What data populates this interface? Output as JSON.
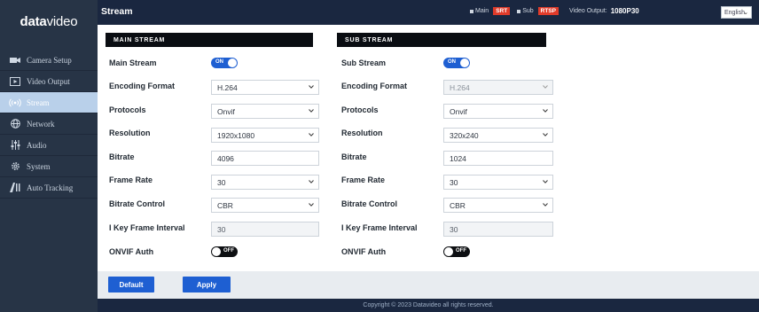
{
  "logo": {
    "text_bold": "data",
    "text_thin": "video"
  },
  "sidebar": {
    "items": [
      {
        "label": "Camera Setup",
        "icon": "camera-icon",
        "active": false
      },
      {
        "label": "Video Output",
        "icon": "video-output-icon",
        "active": false
      },
      {
        "label": "Stream",
        "icon": "stream-icon",
        "active": true
      },
      {
        "label": "Network",
        "icon": "network-icon",
        "active": false
      },
      {
        "label": "Audio",
        "icon": "audio-icon",
        "active": false
      },
      {
        "label": "System",
        "icon": "gear-icon",
        "active": false
      },
      {
        "label": "Auto Tracking",
        "icon": "auto-tracking-icon",
        "active": false
      }
    ]
  },
  "header": {
    "title": "Stream",
    "main_label": "Main",
    "main_tag": "SRT",
    "sub_label": "Sub",
    "sub_tag": "RTSP",
    "video_output_label": "Video Output:",
    "video_output_value": "1080P30",
    "language": "English"
  },
  "main_stream": {
    "section_title": "MAIN STREAM",
    "enable_label": "Main Stream",
    "enable_state": "ON",
    "encoding_label": "Encoding Format",
    "encoding_value": "H.264",
    "protocols_label": "Protocols",
    "protocols_value": "Onvif",
    "resolution_label": "Resolution",
    "resolution_value": "1920x1080",
    "bitrate_label": "Bitrate",
    "bitrate_value": "4096",
    "framerate_label": "Frame Rate",
    "framerate_value": "30",
    "bitrate_control_label": "Bitrate Control",
    "bitrate_control_value": "CBR",
    "ikey_label": "I Key Frame Interval",
    "ikey_value": "30",
    "onvif_auth_label": "ONVIF Auth",
    "onvif_auth_state": "OFF"
  },
  "sub_stream": {
    "section_title": "SUB STREAM",
    "enable_label": "Sub Stream",
    "enable_state": "ON",
    "encoding_label": "Encoding Format",
    "encoding_value": "H.264",
    "protocols_label": "Protocols",
    "protocols_value": "Onvif",
    "resolution_label": "Resolution",
    "resolution_value": "320x240",
    "bitrate_label": "Bitrate",
    "bitrate_value": "1024",
    "framerate_label": "Frame Rate",
    "framerate_value": "30",
    "bitrate_control_label": "Bitrate Control",
    "bitrate_control_value": "CBR",
    "ikey_label": "I Key Frame Interval",
    "ikey_value": "30",
    "onvif_auth_label": "ONVIF Auth",
    "onvif_auth_state": "OFF"
  },
  "buttons": {
    "default_label": "Default",
    "apply_label": "Apply"
  },
  "footer": {
    "copyright": "Copyright © 2023 Datavideo all rights reserved."
  },
  "colors": {
    "accent_blue": "#1e5fd2",
    "sidebar_bg": "#273446",
    "header_bg": "#1a2740",
    "tag_red": "#e03b2a",
    "active_nav": "#b9d0ea"
  }
}
